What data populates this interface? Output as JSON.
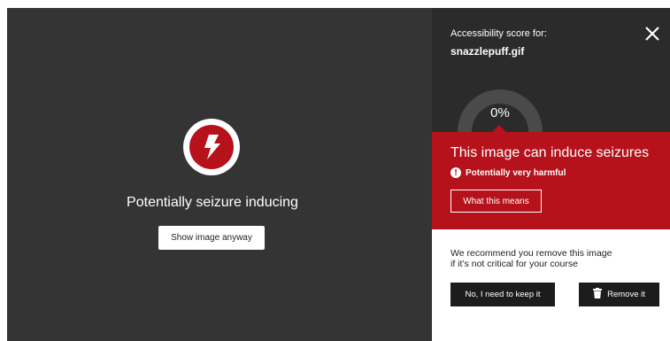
{
  "left": {
    "title": "Potentially seizure inducing",
    "show_button": "Show image anyway",
    "icon": "lightning-bolt-icon",
    "colors": {
      "background": "#343434",
      "danger": "#b5121b"
    }
  },
  "panel": {
    "score_label": "Accessibility score for:",
    "filename": "snazzlepuff.gif",
    "close_icon": "close-icon",
    "gauge": {
      "value_text": "0%",
      "value": 0
    },
    "warning": {
      "title": "This image can induce seizures",
      "severity": "Potentially very harmful",
      "means_button": "What this means"
    },
    "recommendation_line1": "We recommend you remove this image",
    "recommendation_line2": "if it’s not critical for your course",
    "keep_button": "No, I need to keep it",
    "remove_button": "Remove it"
  }
}
